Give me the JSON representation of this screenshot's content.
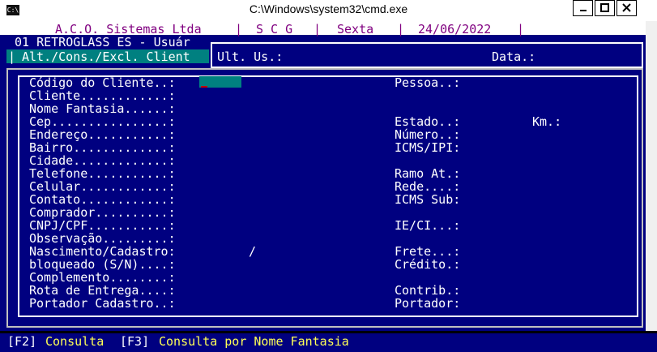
{
  "window": {
    "title": "C:\\Windows\\system32\\cmd.exe",
    "icon": "cmd-icon"
  },
  "top_bar": {
    "company": "A.C.O. Sistemas Ltda",
    "system": "S C G",
    "weekday": "Sexta",
    "date": "24/06/2022"
  },
  "header": {
    "company_user": "01 RETROGLASS ES - Usuár",
    "mode": "Alt./Cons./Excl. Client"
  },
  "dialog": {
    "last_user_label": "Ult. Us.:",
    "date_label": "Data.:"
  },
  "form": {
    "left_labels": [
      "Código do Cliente..:",
      "Cliente............:",
      "Nome Fantasia......:",
      "Cep................:",
      "Endereço...........:",
      "Bairro.............:",
      "Cidade.............:",
      "Telefone...........:",
      "Celular............:",
      "Contato............:",
      "Comprador..........:",
      "CNPJ/CPF...........:",
      "Observação.........:",
      "Nascimento/Cadastro:",
      "bloqueado (S/N)....:",
      "Complemento........:",
      "Rota de Entrega....:",
      "Portador Cadastro..:"
    ],
    "right_labels": {
      "pessoa": "Pessoa..:",
      "estado": "Estado..:",
      "km": "Km.:",
      "numero": "Número..:",
      "icms_ipi": "ICMS/IPI:",
      "ramo": "Ramo At.:",
      "rede": "Rede....:",
      "icms_sub": "ICMS Sub:",
      "ie_ci": "IE/CI...:",
      "frete": "Frete...:",
      "credito": "Crédito.:",
      "contrib": "Contrib.:",
      "portador": "Portador:"
    },
    "date_separator": "/"
  },
  "footer": {
    "f2_key": "[F2]",
    "f2_label": "Consulta",
    "f3_key": "[F3]",
    "f3_label": "Consulta por Nome Fantasia"
  },
  "colors": {
    "background": "#000080",
    "text": "#ffffff",
    "accent": "#008080",
    "highlight": "#ffff55",
    "header_text": "#800080"
  }
}
